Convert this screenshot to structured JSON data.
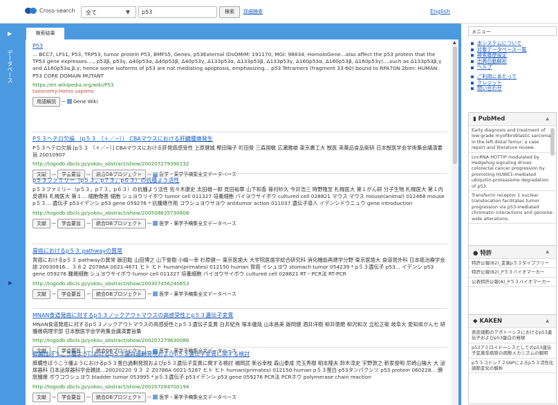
{
  "header": {
    "logo_text": "Cross-search",
    "scope_value": "全て",
    "query": "p53",
    "search_label": "検索",
    "advanced_label": "詳細検索",
    "english_label": "English"
  },
  "sidebar": {
    "label": "データベース"
  },
  "tab": {
    "label": "検索結果"
  },
  "results": [
    {
      "title": "P53",
      "body": "... BCC7, LFS1, P53, TRP53, tumor protein P53, BMFS5, Genes, p53External IDsOMIM: 191170; MGI: 98834; HomoloGene...also affect the p53 protein that the TP53 gene expresses...., p53β, p53γ, Δ40p53α, Δ40p53β, Δ40p53γ, Δ133p53α, Δ133p53β, Δ133p53γ, Δ160p53α, Δ160p53β, Δ160p53γ)....such as Δ133p53β,γ and Δ160p53α,β,γ; hence some isoforms of p53 are not mediating apoptosis, emphasizing... p53 Tetramers (fragment 33-60) bound to RPA70N 2bim: HUMAN P53 CORE DOMAIN MUTANT",
      "url": "https://en.wikipedia.org/wiki/P53",
      "extra": "taxonomy:Homo sapiens",
      "buttons": [
        "用語解説"
      ],
      "db": "Gene Wiki"
    },
    {
      "title": "P５３ヘテロ欠損 （p５３ （＋／−）） CBAマウスにおける肝臓腫瘍発生",
      "body": "P５３ヘテロ欠損 [p５３ （＋／−）] CBAマウスにおける肝発癌感受性 上原健城 樫田陽子 町田登 三森国敏 広瀬雅雄 東京農工大 獣医 来薬品食品衛研 日本獣医学会学術集会講演要旨 20010907",
      "url": "http://togodb.dbcls.jp/yokou_abstract/show/200207279390132",
      "buttons": [
        "文献",
        "学会要旨",
        "統合DBプロジェクト"
      ],
      "db": "医学・薬学予稿集全文データベース"
    },
    {
      "title": "p５３ファミリー（p５３，p７３，p６３）の抗腫よう活性",
      "body": "p５３ファミリー（p５３，p７３，p６３）の抗腫よう活性 佐々木康史 太田雄一郎 見田裕章 山下和香 篠村紗久 今井浩三 時野隆至 札幌医大 第１がん研 分子生物 札幌医大 第１内 皮膚科 札幌医大 第１... 細胞傷害 細胞 シュヨウリイボウ tumor cell 011327 培養細胞 バイヨウサイボウ cultured cell 028821 マウス マウス mouse(animal) 012468 mouse p５３... 遺伝子 p53イデンシ p53 gene 059276 * 抗腫瘍作用 コウシュヨウサヨウ antitumor action 011037 遺伝子導入 イデンシドウニュウ gene introduction",
      "url": "http://togodb.dbcls.jp/yokou_abstract/show/200508635730808",
      "buttons": [
        "文献",
        "学会要旨",
        "統合DBプロジェクト"
      ],
      "db": "医学・薬学予稿集全文データベース"
    },
    {
      "title": "胃癌におけるp５３ pathwayの異常",
      "body": "胃癌におけるp５３ pathwayの異常 飯田聡 山田博之 山下俊樹 小嶋一幸 杉原健一 東京医歯大 大学院医歯学総合研究科 消化機能再建学分野 東京医歯大 食道胃外科 日本癌治療学会誌 20030916... ３８２ Z0786A 0021-4671 ヒト ヒト human(primates) 012150 human 胃癌 イシュヨウ stomach tumor 054239 * p５３遺伝子 p53... イデンシ p53 gene 059276 腫瘍細胞 シュヨウサイボウ tumor cell 011327 培養細胞 バイヨウサイボウ cultured cell 028821 RT・PCR法 RT-PCR",
      "url": "http://togodb.dbcls.jp/yokou_abstract/show/200307456240653",
      "buttons": [
        "文献",
        "学会要旨",
        "統合DBプロジェクト"
      ],
      "db": "医学・薬学予稿集全文データベース"
    },
    {
      "title": "MNAN食道発癌に対するp５３ノックアウトマウスの高感受性とp５３遺伝子変異",
      "body": "MNAN食道発癌に対するp５３ノックアウトマウスの高感受性とp５３遺伝子変異 白井紀充 塚本徹哉 山本昌美 飯岡健 酒井洋樹 柳井徳磨 柳沢和次 立松正衛 岐阜大 愛知県がんセ 研 腫瘍病理学部 日本獣医学会学術集会講演要旨集",
      "url": "http://togodb.dbcls.jp/yokou_abstract/show/200207279630086",
      "buttons": [
        "文献",
        "学会要旨",
        "統合DBプロジェクト"
      ],
      "db": "医学・薬学予稿集全文データベース"
    },
    {
      "title": "膵臓性ぼうこう腫ようにおけるp５３蛋白過剰発現およびp５３遺伝子変異に関する検討",
      "body": "膵臓性ぼうこう腫ようにおけるp５３蛋白過剰発現およびp５３遺伝子変異に関する検討 福岡武 新谷幸枝 森山泰成 児玉秀樹 相本隆夫 鈴木淳史 宇野敦之 新家俊明 尼崎山陽大 大 泌尿器科 日本泌尿器科学会雑誌...20020220 ９３ ２ Z0786A 0021-5287 ヒト ヒト human(primates) 012150 human p５３蛋白 p53タンパクシツ p53 protein 060228... 膀胱腫瘍 ボウコウシュヨウ bladder tumor 053995 * p５３遺伝子 p53イデンシ p53 gene 059276 PCR法 PCRホウ polymerase chain reaction",
      "url": "http://togodb.dbcls.jp/yokou_abstract/show/200207284700194",
      "buttons": [
        "文献",
        "学会要旨",
        "統合DBプロジェクト"
      ],
      "db": "医学・薬学予稿集全文データベース"
    }
  ],
  "menu": {
    "header": "メニュー",
    "items": [
      "本システムについて",
      "対象データベース一覧",
      "検索履歴設定",
      "出典自動解析",
      "ヘルプ"
    ],
    "items2": [
      "ご利用にあたって",
      "クレジット",
      "問い合わせ"
    ]
  },
  "pubmed": {
    "title": "PubMed",
    "items": [
      "Early diagnosis and treatment of low-grade myofibroblastic sarcoma in the left distal femur: a case report and literature review.",
      "LncRNA HOTTIP modulated by Hedgehog signaling drives colorectal cancer progression by promoting HUWE1-mediated ubiquitin-proteasome degradation of p53.",
      "Transferrin receptor 1 nuclear translocation facilitates tumor progression via p53-mediated chromatin interactions and genome-wide alterations."
    ]
  },
  "patent": {
    "title": "特許",
    "items": [
      "特許公報(B2)_変異p５３タイプフリー",
      "特許公報(B2)_P５３バイオマーカー",
      "公表特許公報(A)_P５３バイオマーカー"
    ]
  },
  "kaken": {
    "title": "KAKEN",
    "items": [
      "表皮細胞のアポトーシスにおけるp53遺伝子およびp53蛋白の発現",
      "p53アミロイドーシスとしてのp53遺伝子変異非病原の病態メカニズムの解明",
      "p５３コドン７２SNPによるp５３活性化調節変化の解析"
    ]
  }
}
